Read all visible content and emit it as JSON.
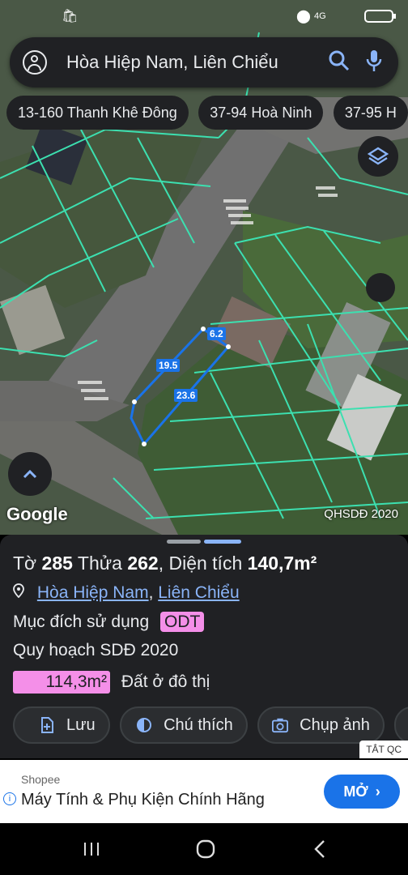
{
  "search": {
    "query": "Hòa Hiệp Nam, Liên Chiểu"
  },
  "chips": [
    "13-160 Thanh Khê Đông",
    "37-94 Hoà Ninh",
    "37-95 H"
  ],
  "map": {
    "google_label": "Google",
    "overlay_label": "QHSDĐ 2020",
    "measurements": [
      "6.2",
      "19.5",
      "23.6"
    ]
  },
  "parcel": {
    "to_label": "Tờ",
    "to_value": "285",
    "thua_label": "Thửa",
    "thua_value": "262",
    "area_label": "Diện tích",
    "area_value": "140,7m²",
    "ward_link": "Hòa Hiệp Nam",
    "district_link": "Liên Chiểu",
    "purpose_label": "Mục đích sử dụng",
    "purpose_code": "ODT",
    "plan_label": "Quy hoạch SDĐ 2020",
    "plan_area": "114,3m²",
    "plan_type": "Đất ở đô thị"
  },
  "actions": [
    {
      "label": "Lưu",
      "icon": "save-icon"
    },
    {
      "label": "Chú thích",
      "icon": "legend-icon"
    },
    {
      "label": "Chụp ảnh",
      "icon": "camera-icon"
    }
  ],
  "ad": {
    "badge": "TẮT QC",
    "brand": "Shopee",
    "title": "Máy Tính & Phụ Kiện Chính Hãng",
    "cta": "MỞ"
  },
  "colors": {
    "accent": "#1a73e8",
    "highlight": "#f48fe8",
    "panel": "#202124",
    "parcel_lines": "#3ce0b0"
  }
}
